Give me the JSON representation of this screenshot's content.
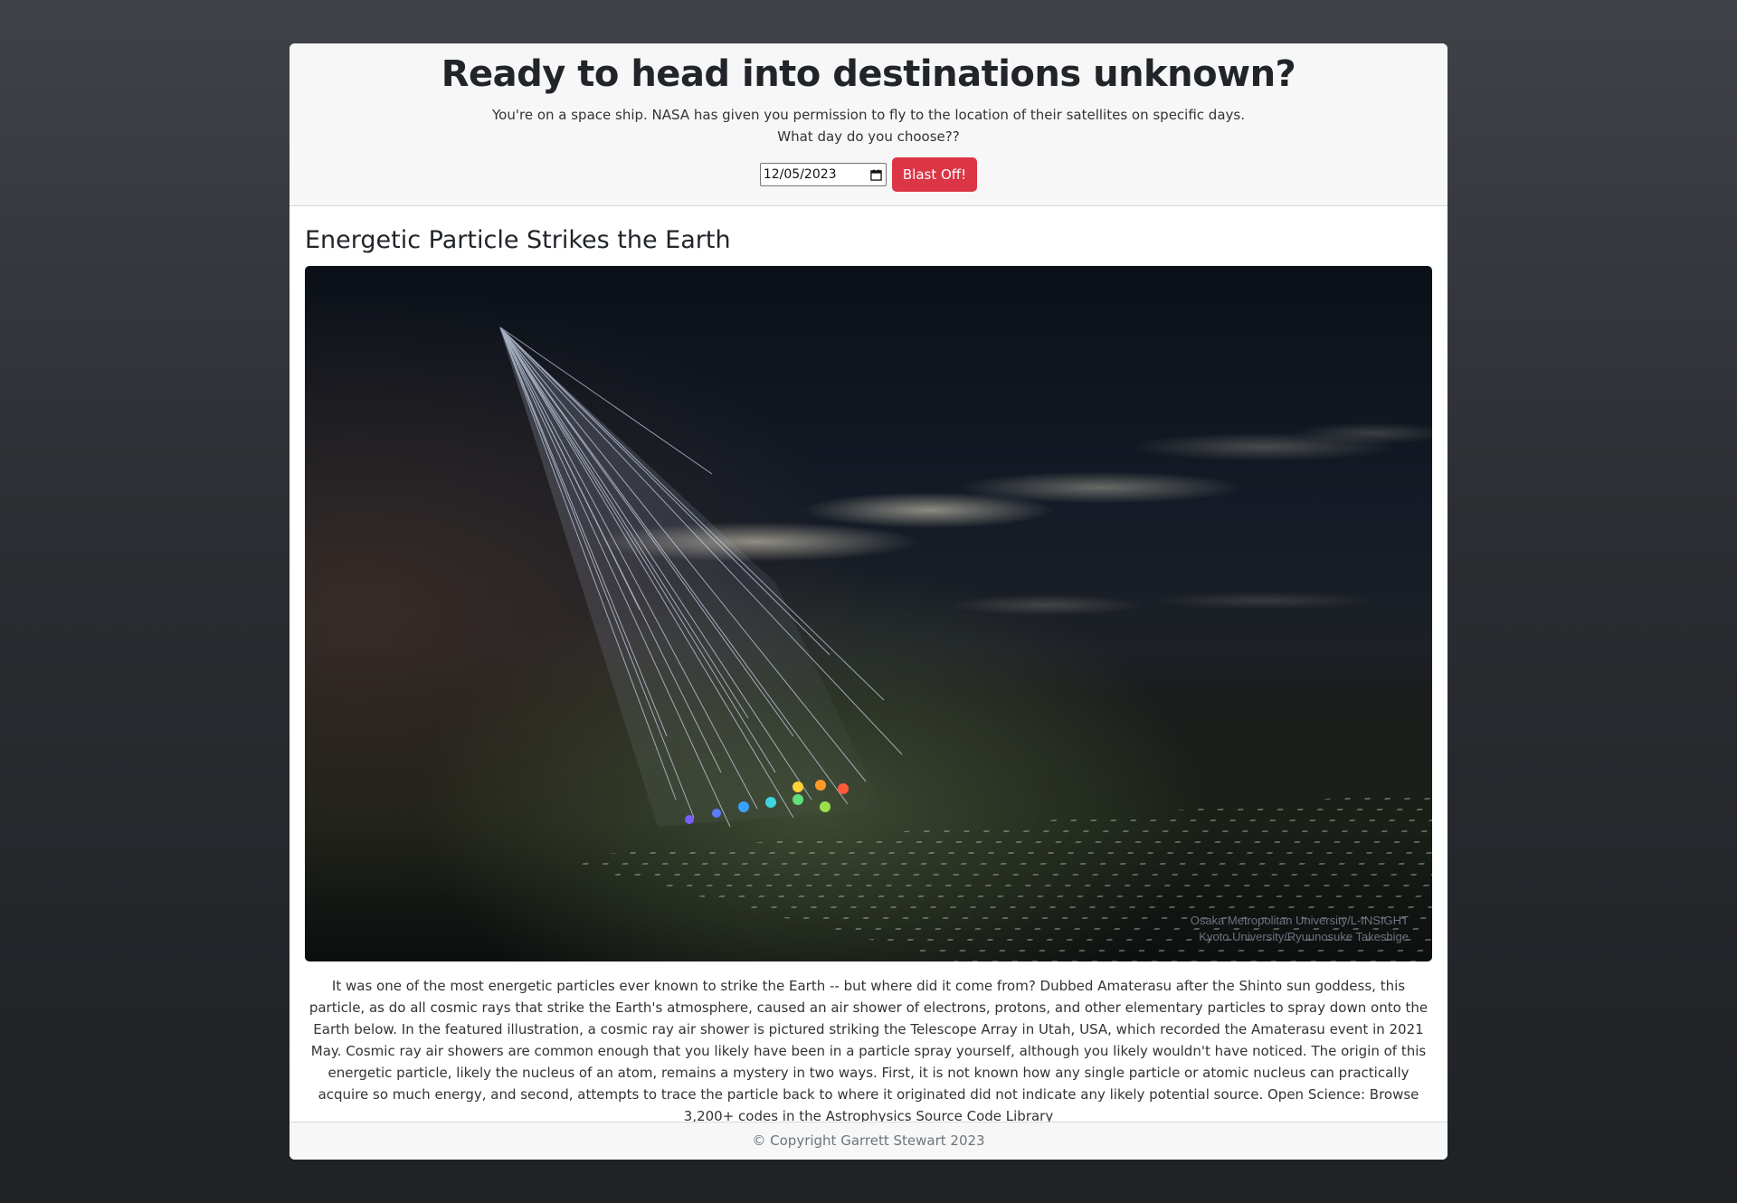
{
  "header": {
    "title": "Ready to head into destinations unknown?",
    "intro_line1": "You're on a space ship. NASA has given you permission to fly to the location of their satellites on specific days.",
    "intro_line2": "What day do you choose??",
    "date_value": "12/05/2023",
    "submit_label": "Blast Off!"
  },
  "apod": {
    "title": "Energetic Particle Strikes the Earth",
    "image_alt": "Energetic Particle Strikes the Earth",
    "credit_line1": "Osaka Metropolitan University/L-INSIGHT",
    "credit_line2": "Kyoto University/Ryuunosuke Takeshige",
    "explanation": "It was one of the most energetic particles ever known to strike the Earth -- but where did it come from? Dubbed Amaterasu after the Shinto sun goddess, this particle, as do all cosmic rays that strike the Earth's atmosphere, caused an air shower of electrons, protons, and other elementary particles to spray down onto the Earth below. In the featured illustration, a cosmic ray air shower is pictured striking the Telescope Array in Utah, USA, which recorded the Amaterasu event in 2021 May. Cosmic ray air showers are common enough that you likely have been in a particle spray yourself, although you likely wouldn't have noticed. The origin of this energetic particle, likely the nucleus of an atom, remains a mystery in two ways. First, it is not known how any single particle or atomic nucleus can practically acquire so much energy, and second, attempts to trace the particle back to where it originated did not indicate any likely potential source. Open Science: Browse 3,200+ codes in the Astrophysics Source Code Library"
  },
  "footer": {
    "copyright": "© Copyright Garrett Stewart 2023"
  },
  "icons": {
    "calendar": "calendar-icon"
  },
  "colors": {
    "accent": "#dc3545",
    "header_bg": "#f7f7f7"
  }
}
